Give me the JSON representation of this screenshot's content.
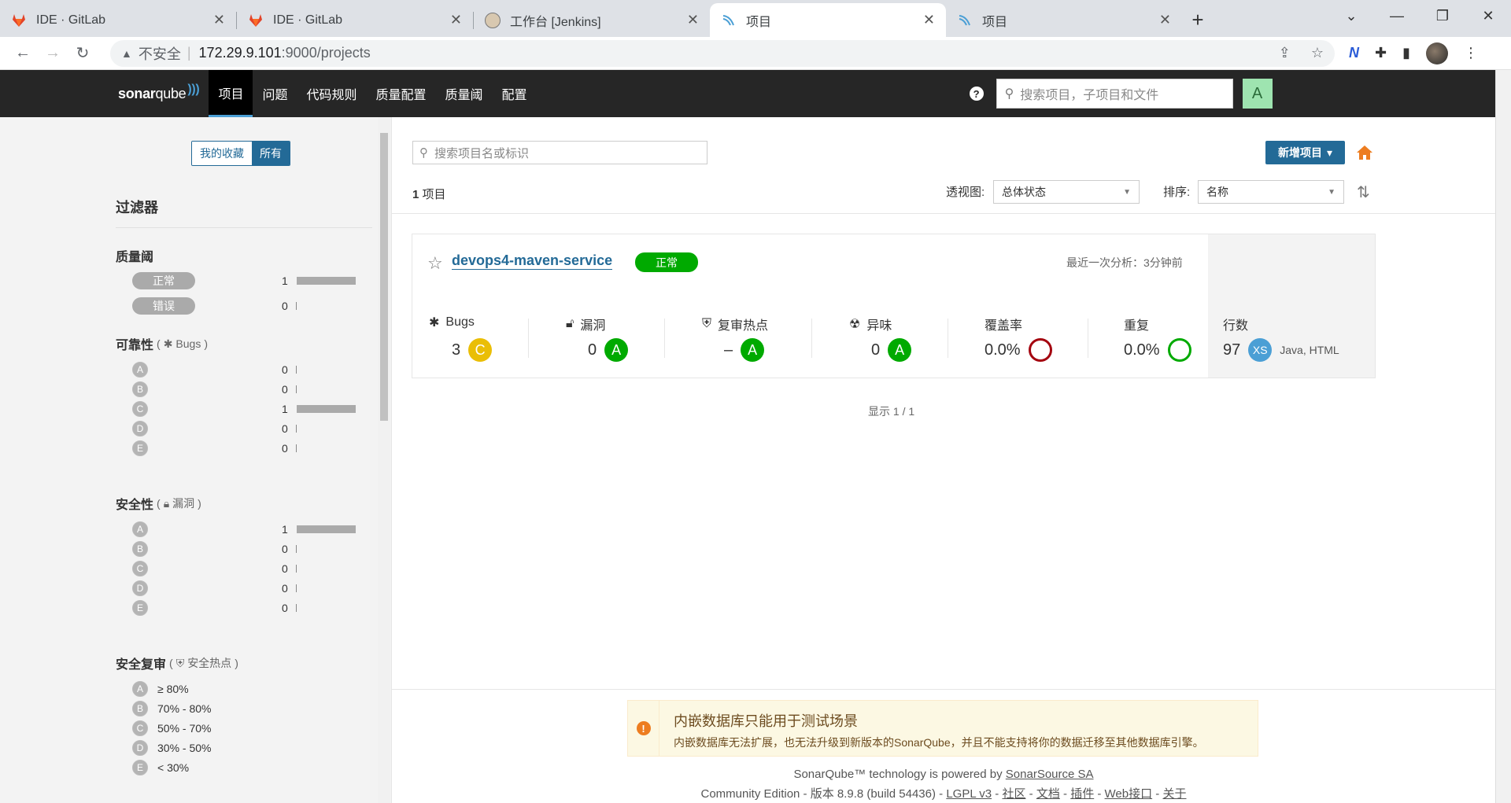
{
  "browser": {
    "tabs": [
      {
        "title": "IDE · GitLab",
        "icon": "gitlab-icon"
      },
      {
        "title": "IDE · GitLab",
        "icon": "gitlab-icon"
      },
      {
        "title": "工作台 [Jenkins]",
        "icon": "jenkins-icon"
      },
      {
        "title": "项目",
        "icon": "sonarqube-icon",
        "active": true
      },
      {
        "title": "项目",
        "icon": "sonarqube-icon"
      }
    ],
    "insecure_label": "不安全",
    "url_host": "172.29.9.101",
    "url_path": ":9000/projects"
  },
  "nav": {
    "logo_sonar": "sonar",
    "logo_qube": "qube",
    "items": [
      "项目",
      "问题",
      "代码规则",
      "质量配置",
      "质量阈",
      "配置"
    ],
    "active_index": 0,
    "search_placeholder": "搜索项目，子项目和文件",
    "user_initial": "A"
  },
  "sidebar": {
    "favorites_label": "我的收藏",
    "all_label": "所有",
    "filters_title": "过滤器",
    "quality_gate": {
      "title": "质量阈",
      "rows": [
        {
          "label": "正常",
          "count": "1",
          "fraction": 1.0
        },
        {
          "label": "错误",
          "count": "0",
          "fraction": 0
        }
      ]
    },
    "reliability": {
      "title": "可靠性",
      "sub": "Bugs",
      "rows": [
        {
          "grade": "A",
          "count": "0",
          "fraction": 0
        },
        {
          "grade": "B",
          "count": "0",
          "fraction": 0
        },
        {
          "grade": "C",
          "count": "1",
          "fraction": 1.0
        },
        {
          "grade": "D",
          "count": "0",
          "fraction": 0
        },
        {
          "grade": "E",
          "count": "0",
          "fraction": 0
        }
      ]
    },
    "security": {
      "title": "安全性",
      "sub": "漏洞",
      "rows": [
        {
          "grade": "A",
          "count": "1",
          "fraction": 1.0
        },
        {
          "grade": "B",
          "count": "0",
          "fraction": 0
        },
        {
          "grade": "C",
          "count": "0",
          "fraction": 0
        },
        {
          "grade": "D",
          "count": "0",
          "fraction": 0
        },
        {
          "grade": "E",
          "count": "0",
          "fraction": 0
        }
      ]
    },
    "security_review": {
      "title": "安全复审",
      "sub": "安全热点",
      "rows": [
        {
          "grade": "A",
          "range": "≥ 80%"
        },
        {
          "grade": "B",
          "range": "70% - 80%"
        },
        {
          "grade": "C",
          "range": "50% - 70%"
        },
        {
          "grade": "D",
          "range": "30% - 50%"
        },
        {
          "grade": "E",
          "range": "< 30%"
        }
      ]
    }
  },
  "main": {
    "search_placeholder": "搜索项目名或标识",
    "new_project_label": "新增项目",
    "count_number": "1",
    "count_label": "项目",
    "perspective_label": "透视图:",
    "perspective_value": "总体状态",
    "sort_label": "排序:",
    "sort_value": "名称",
    "pagination": "显示 1 / 1"
  },
  "project": {
    "name": "devops4-maven-service",
    "quality_gate": "正常",
    "last_analysis": "最近一次分析：3分钟前",
    "metrics": {
      "bugs_label": "Bugs",
      "bugs_value": "3",
      "bugs_grade": "C",
      "vuln_label": "漏洞",
      "vuln_value": "0",
      "vuln_grade": "A",
      "hotspot_label": "复审热点",
      "hotspot_value": "–",
      "hotspot_grade": "A",
      "smell_label": "异味",
      "smell_value": "0",
      "smell_grade": "A",
      "coverage_label": "覆盖率",
      "coverage_value": "0.0%",
      "dup_label": "重复",
      "dup_value": "0.0%",
      "lines_label": "行数",
      "lines_value": "97",
      "size": "XS",
      "languages": "Java, HTML"
    }
  },
  "footer": {
    "alert_title": "内嵌数据库只能用于测试场景",
    "alert_text": "内嵌数据库无法扩展，也无法升级到新版本的SonarQube，并且不能支持将你的数据迁移至其他数据库引擎。",
    "powered_prefix": "SonarQube™ technology is powered by",
    "powered_link": "SonarSource SA",
    "edition": "Community Edition - 版本 8.9.8 (build 54436) -",
    "links": [
      "LGPL v3",
      "社区",
      "文档",
      "插件",
      "Web接口",
      "关于"
    ]
  },
  "colors": {
    "nav_bg": "#262626",
    "primary": "#236a97",
    "status_ok": "#00aa00",
    "grade_c": "#eabe06",
    "coverage_bad": "#a4030f"
  }
}
